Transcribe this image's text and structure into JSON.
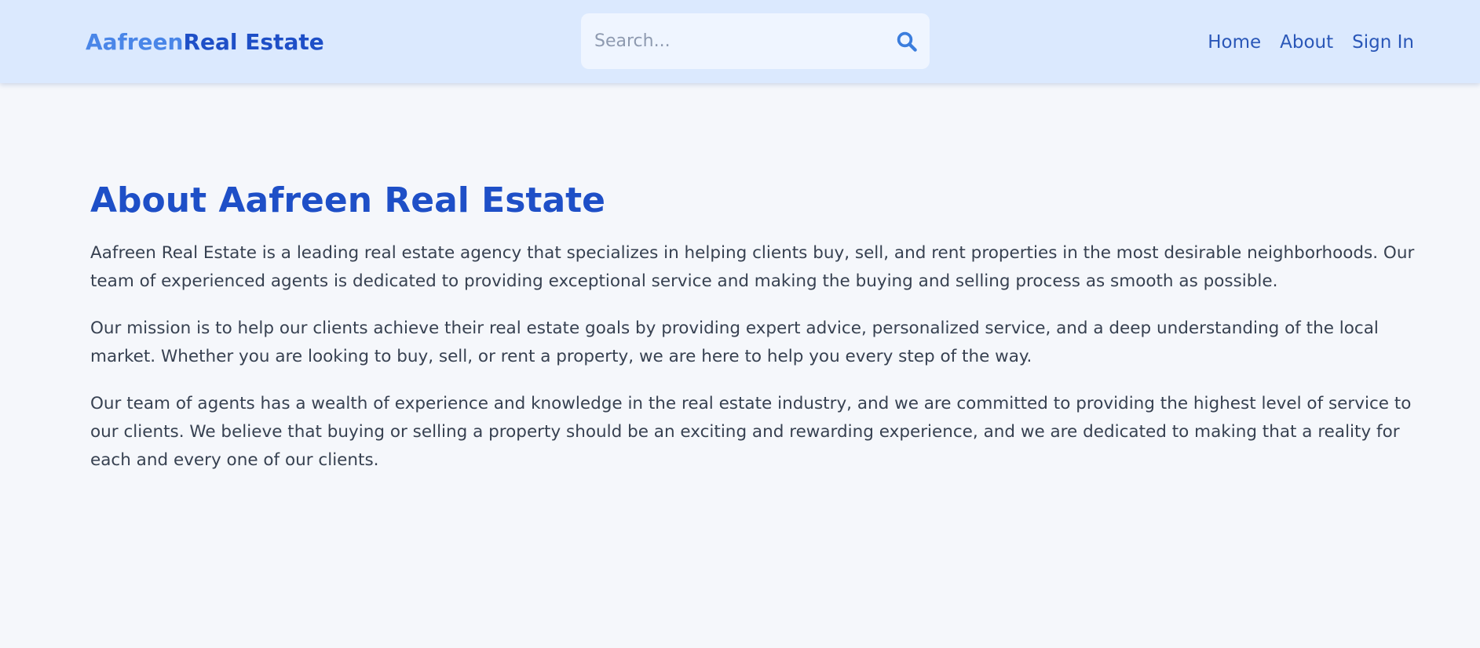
{
  "header": {
    "logo": {
      "part1": "Aafreen",
      "part2": "Real Estate"
    },
    "search": {
      "placeholder": "Search..."
    },
    "nav": [
      {
        "label": "Home"
      },
      {
        "label": "About"
      },
      {
        "label": "Sign In"
      }
    ]
  },
  "about": {
    "title": "About Aafreen Real Estate",
    "paragraphs": [
      "Aafreen Real Estate is a leading real estate agency that specializes in helping clients buy, sell, and rent properties in the most desirable neighborhoods. Our team of experienced agents is dedicated to providing exceptional service and making the buying and selling process as smooth as possible.",
      "Our mission is to help our clients achieve their real estate goals by providing expert advice, personalized service, and a deep understanding of the local market. Whether you are looking to buy, sell, or rent a property, we are here to help you every step of the way.",
      "Our team of agents has a wealth of experience and knowledge in the real estate industry, and we are committed to providing the highest level of service to our clients. We believe that buying or selling a property should be an exciting and rewarding experience, and we are dedicated to making that a reality for each and every one of our clients."
    ]
  },
  "icons": {
    "search": "search-icon"
  },
  "colors": {
    "header_bg": "#dbe9fe",
    "page_bg": "#f5f7fb",
    "brand_light": "#4a86e8",
    "brand_dark": "#1e4fc7",
    "nav_link": "#2a57b8",
    "body_text": "#374151"
  }
}
